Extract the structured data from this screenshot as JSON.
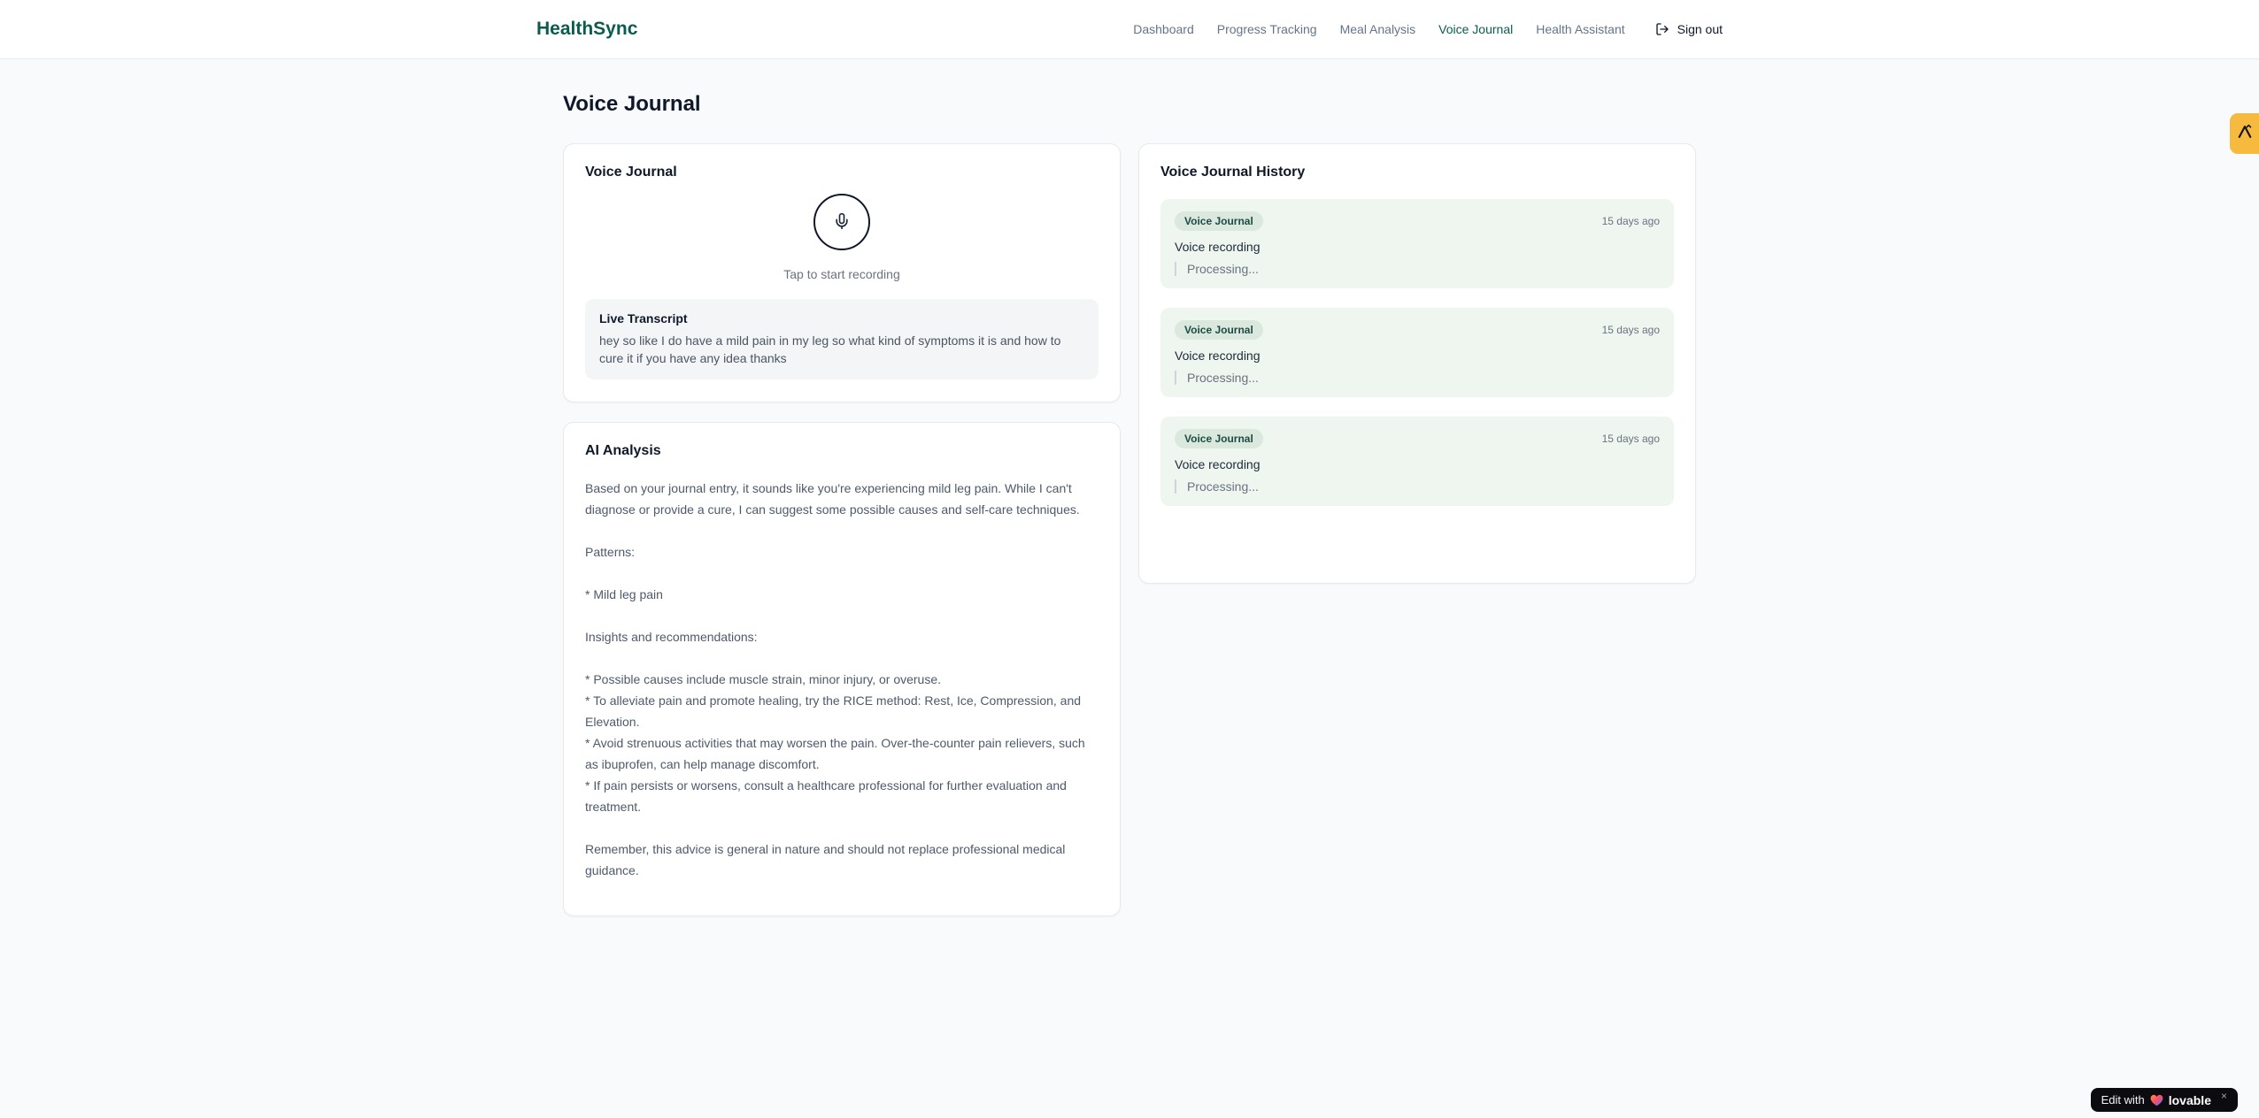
{
  "brand": {
    "name": "HealthSync",
    "color": "#0b5c50"
  },
  "nav": {
    "items": [
      {
        "label": "Dashboard",
        "active": false
      },
      {
        "label": "Progress Tracking",
        "active": false
      },
      {
        "label": "Meal Analysis",
        "active": false
      },
      {
        "label": "Voice Journal",
        "active": true
      },
      {
        "label": "Health Assistant",
        "active": false
      }
    ],
    "sign_out_label": "Sign out"
  },
  "page": {
    "title": "Voice Journal"
  },
  "recorder": {
    "title": "Voice Journal",
    "hint": "Tap to start recording",
    "mic_icon": "microphone-icon",
    "transcript_title": "Live Transcript",
    "transcript_text": "hey so like I do have a mild pain in my leg so what kind of symptoms it is and how to cure it if you have any idea thanks"
  },
  "analysis": {
    "title": "AI Analysis",
    "body": "Based on your journal entry, it sounds like you're experiencing mild leg pain. While I can't diagnose or provide a cure, I can suggest some possible causes and self-care techniques.\n\nPatterns:\n\n* Mild leg pain\n\nInsights and recommendations:\n\n* Possible causes include muscle strain, minor injury, or overuse.\n* To alleviate pain and promote healing, try the RICE method: Rest, Ice, Compression, and Elevation.\n* Avoid strenuous activities that may worsen the pain. Over-the-counter pain relievers, such as ibuprofen, can help manage discomfort.\n* If pain persists or worsens, consult a healthcare professional for further evaluation and treatment.\n\nRemember, this advice is general in nature and should not replace professional medical guidance."
  },
  "history": {
    "title": "Voice Journal History",
    "entries": [
      {
        "badge": "Voice Journal",
        "time": "15 days ago",
        "label": "Voice recording",
        "status": "Processing..."
      },
      {
        "badge": "Voice Journal",
        "time": "15 days ago",
        "label": "Voice recording",
        "status": "Processing..."
      },
      {
        "badge": "Voice Journal",
        "time": "15 days ago",
        "label": "Voice recording",
        "status": "Processing..."
      }
    ],
    "entry_accent_color": "#eef6ef",
    "badge_color": "#dbe8de"
  },
  "widgets": {
    "lovable": {
      "prefix": "Edit with",
      "brand": "lovable",
      "close": "×"
    }
  }
}
